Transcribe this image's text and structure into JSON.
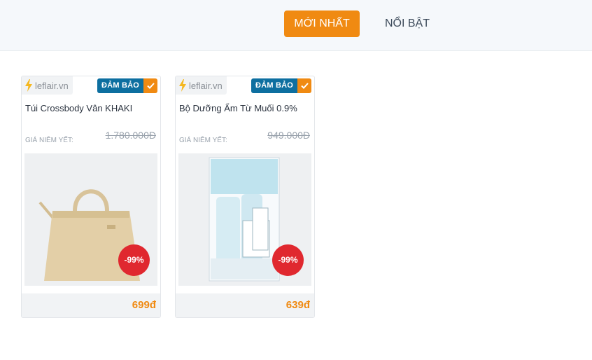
{
  "tabs": {
    "newest": "MỚI NHẤT",
    "featured": "NỔI BẬT"
  },
  "products": [
    {
      "source": "leflair.vn",
      "badge": "ĐẢM BẢO",
      "name": "Túi Crossbody Vân KHAKI",
      "price_label": "GIÁ NIÊM YẾT:",
      "old_price": "1.780.000Đ",
      "discount": "-99%",
      "price": "699đ"
    },
    {
      "source": "leflair.vn",
      "badge": "ĐẢM BẢO",
      "name": "Bộ Dưỡng Ẩm Từ Muối 0.9%",
      "price_label": "GIÁ NIÊM YẾT:",
      "old_price": "949.000Đ",
      "discount": "-99%",
      "price": "639đ"
    }
  ],
  "colors": {
    "accent": "#f08a12",
    "badge": "#0d6fa0",
    "discount": "#e0282f"
  },
  "icons": [
    "lightning-icon",
    "check-icon"
  ]
}
